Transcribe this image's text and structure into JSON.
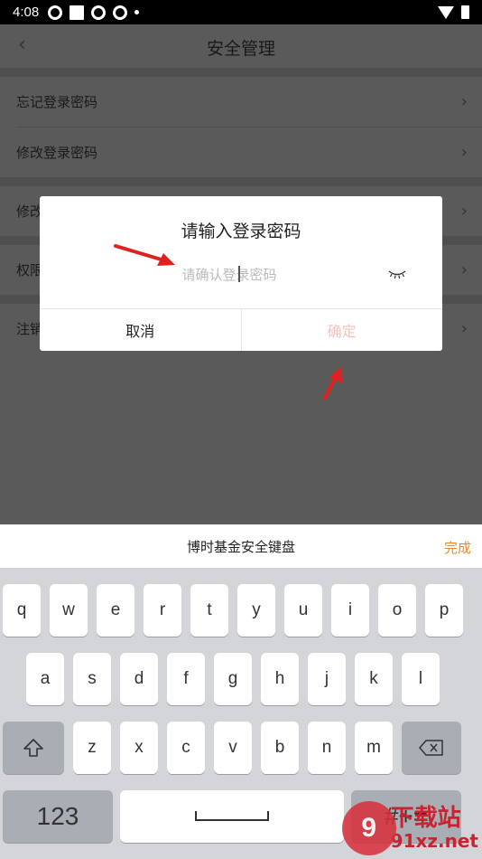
{
  "status_bar": {
    "time": "4:08",
    "icons": [
      "shutter-icon",
      "square-icon",
      "shutter-icon",
      "shutter-icon",
      "dot-icon"
    ],
    "right_icons": [
      "wifi-icon",
      "battery-icon"
    ]
  },
  "page": {
    "title": "安全管理",
    "back_icon": "chevron-left-icon",
    "items": [
      {
        "label": "忘记登录密码"
      },
      {
        "label": "修改登录密码"
      },
      {
        "label": "修改"
      },
      {
        "label": "权限"
      },
      {
        "label": "注销"
      }
    ]
  },
  "dialog": {
    "title": "请输入登录密码",
    "input_placeholder": "请确认登录密码",
    "input_value": "",
    "eye_icon": "eye-closed-icon",
    "cancel_label": "取消",
    "confirm_label": "确定",
    "confirm_color": "#f4c2bd"
  },
  "keyboard": {
    "title": "博时基金安全键盘",
    "done_label": "完成",
    "done_color": "#f0881f",
    "row1": [
      "q",
      "w",
      "e",
      "r",
      "t",
      "y",
      "u",
      "i",
      "o",
      "p"
    ],
    "row2": [
      "a",
      "s",
      "d",
      "f",
      "g",
      "h",
      "j",
      "k",
      "l"
    ],
    "row3": [
      "z",
      "x",
      "c",
      "v",
      "b",
      "n",
      "m"
    ],
    "numbers_label": "123",
    "symbols_label": "#+="
  },
  "watermark": {
    "badge": "9",
    "line1": "下载站",
    "line2": "91xz.net"
  },
  "colors": {
    "accent_orange": "#f0881f",
    "arrow_red": "#e0221f"
  }
}
